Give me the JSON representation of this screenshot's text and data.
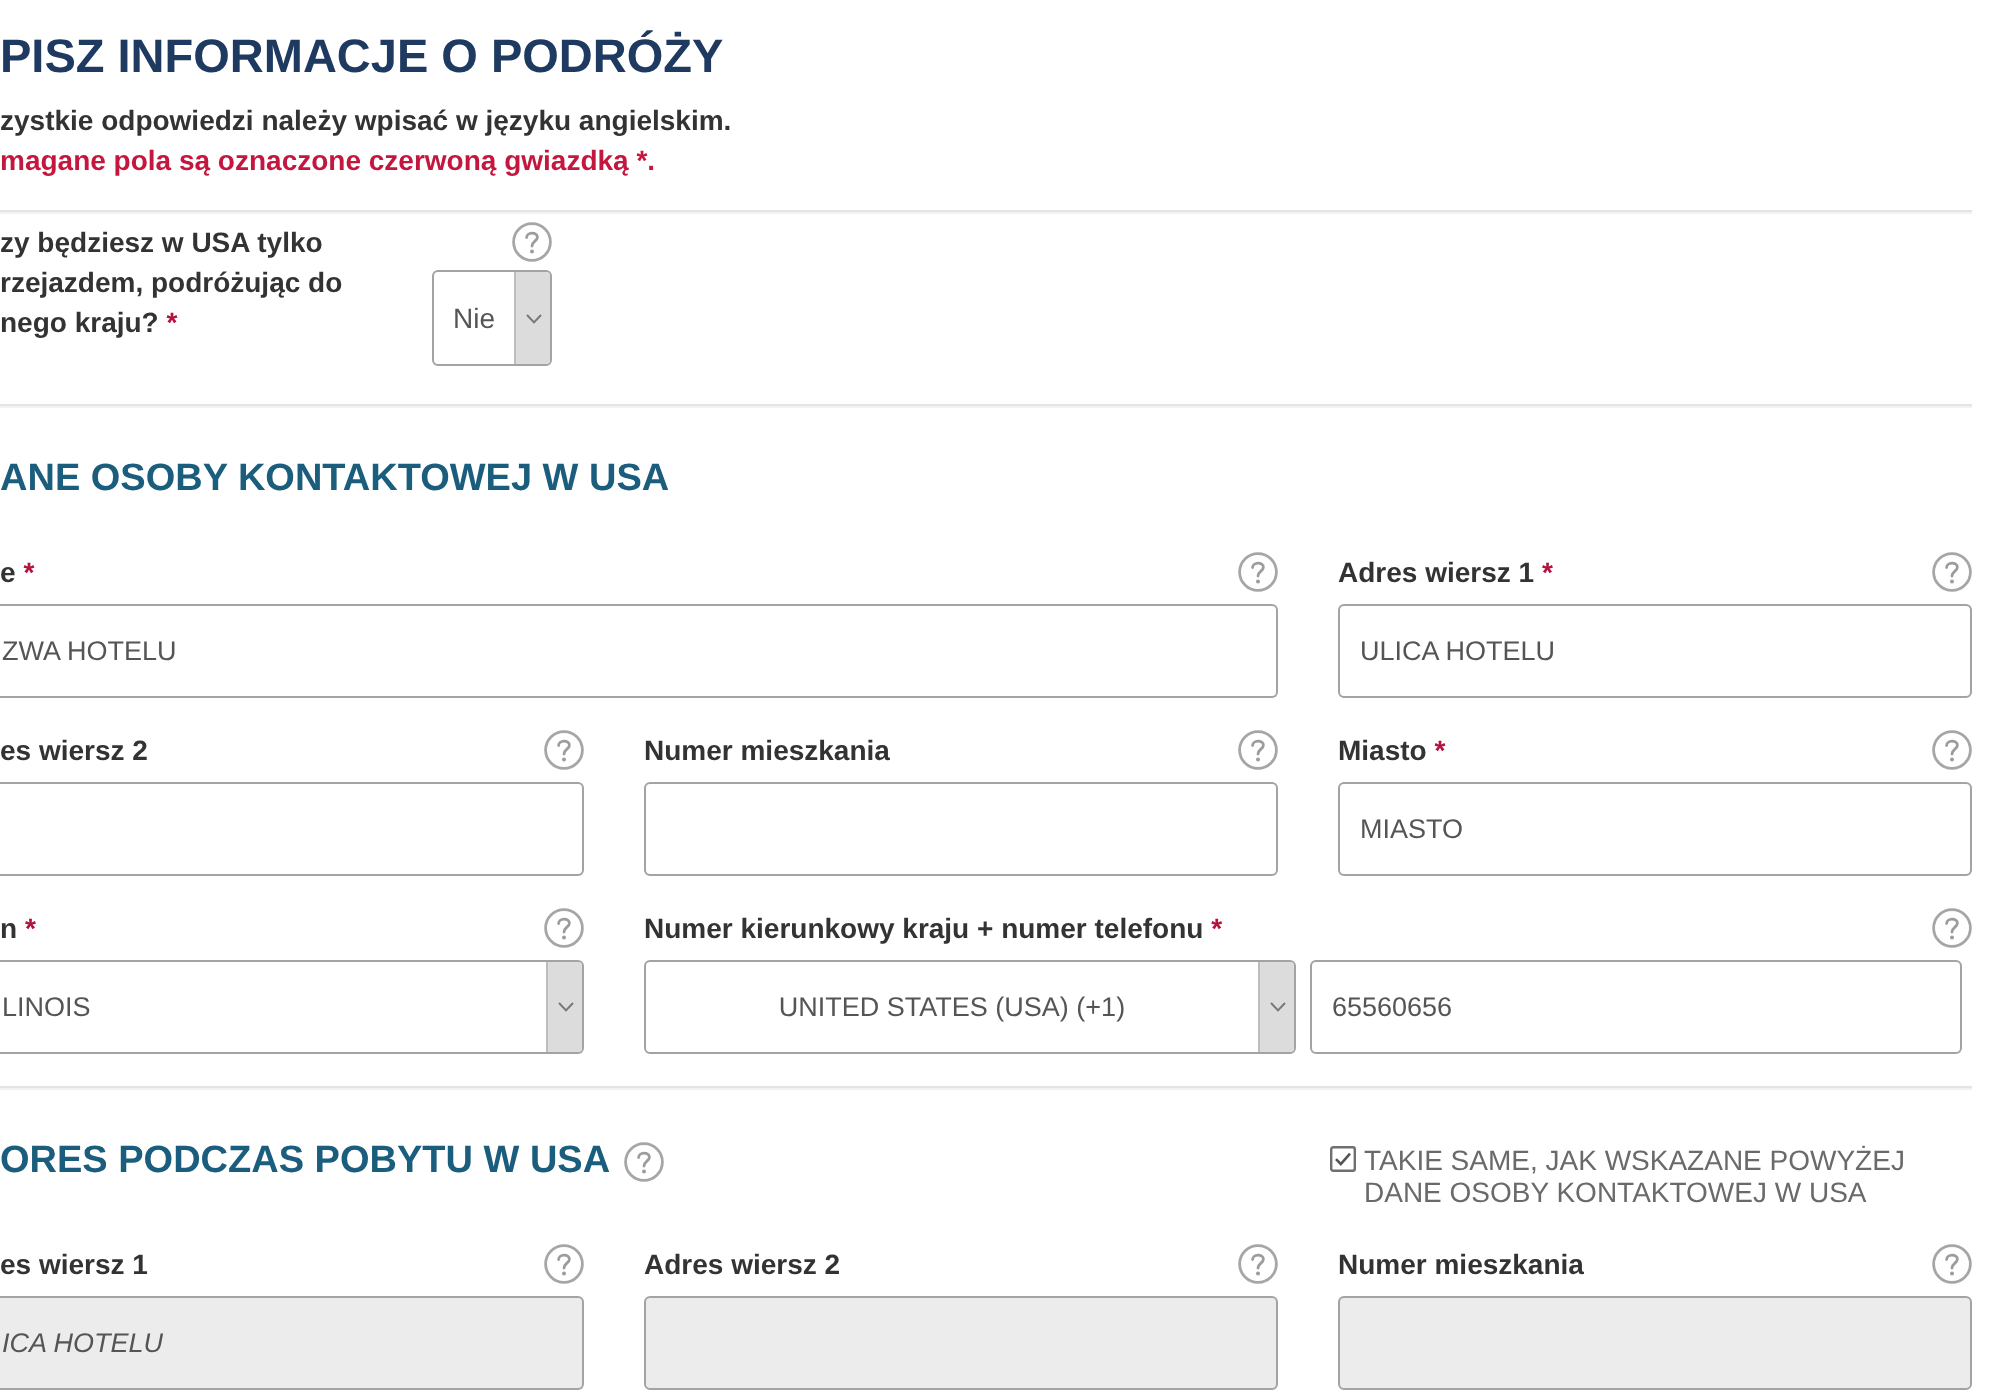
{
  "page": {
    "title": "PISZ INFORMACJE O PODRÓŻY",
    "notes": [
      {
        "kind": "info",
        "text": "zystkie odpowiedzi należy wpisać w języku angielskim."
      },
      {
        "kind": "required",
        "text": "magane pola są oznaczone czerwoną gwiazdką *."
      }
    ]
  },
  "transit_question": {
    "lines": [
      "zy będziesz w USA tylko",
      "rzejazdem, podróżując do",
      "nego kraju?"
    ],
    "asterisk": "*",
    "answer": "Nie"
  },
  "contact_section": {
    "heading": "ANE OSOBY KONTAKTOWEJ W USA",
    "help": false,
    "fields": [
      {
        "kind": "wide_text",
        "label": "e",
        "asterisk": "*",
        "value": "ZWA HOTELU",
        "disabled": false
      },
      {
        "kind": "text",
        "label": "Adres wiersz 1",
        "asterisk": "*",
        "value": "ULICA HOTELU",
        "disabled": false
      },
      {
        "kind": "text",
        "label": "es wiersz 2",
        "disabled": false
      },
      {
        "kind": "text",
        "label": "Numer mieszkania",
        "disabled": false
      },
      {
        "kind": "text",
        "label": "Miasto",
        "asterisk": "*",
        "value": "MIASTO",
        "disabled": false
      },
      {
        "kind": "select",
        "label": "n",
        "asterisk": "*",
        "value": "LINOIS"
      },
      {
        "kind": "phone",
        "label": "Numer kierunkowy kraju + numer telefonu",
        "asterisk": "*",
        "country": "UNITED STATES (USA) (+1)",
        "value": "65560656",
        "disabled": false
      }
    ]
  },
  "address_section": {
    "heading": "ORES PODCZAS POBYTU W USA",
    "help": true,
    "same_as_contact": {
      "label": "TAKIE SAME, JAK WSKAZANE POWYŻEJ DANE OSOBY KONTAKTOWEJ W USA",
      "checked": true
    },
    "fields": [
      {
        "kind": "text",
        "label": "es wiersz 1",
        "value": "ICA HOTELU",
        "disabled": true
      },
      {
        "kind": "text",
        "label": "Adres wiersz 2",
        "disabled": true
      },
      {
        "kind": "text",
        "label": "Numer mieszkania",
        "disabled": true
      }
    ]
  }
}
